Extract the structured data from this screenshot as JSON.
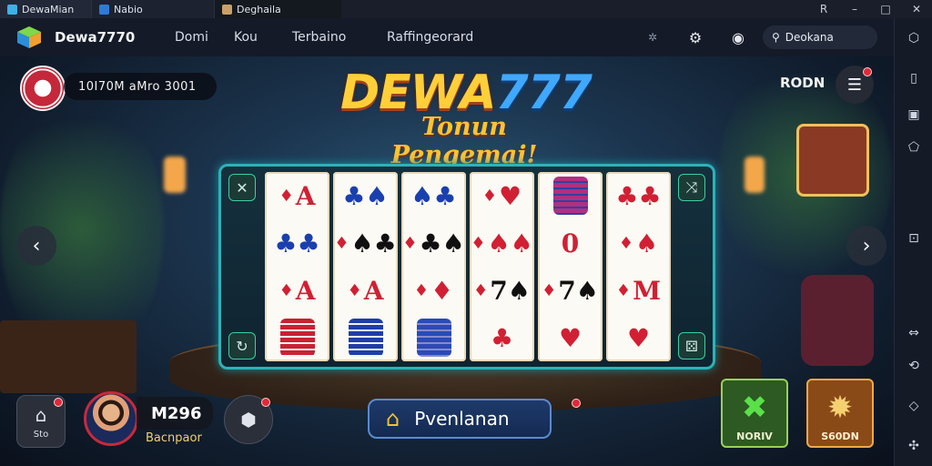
{
  "window": {
    "tabs": [
      {
        "label": "DewaMian",
        "icon": "app-icon"
      },
      {
        "label": "Nabio",
        "icon": "window-icon"
      },
      {
        "label": "Deghaila",
        "icon": "page-icon"
      }
    ],
    "controls": [
      "R",
      "–",
      "□",
      "✕"
    ]
  },
  "nav": {
    "brand": "Dewa7770",
    "links": [
      "Domi",
      "Kou",
      "Terbaino",
      "Raffingeorard"
    ],
    "search_label": "Deokana"
  },
  "game": {
    "coins": "10I70M aMro 3001",
    "title_text": "DEWA",
    "title_num": "777",
    "subtitle": "Tonun Pengemai!",
    "top_right_label": "RODN",
    "reels": [
      [
        {
          "t": "A",
          "s": "♦",
          "c": "red"
        },
        {
          "t": "♣♣",
          "s": "",
          "c": "blue"
        },
        {
          "t": "A",
          "s": "♦",
          "c": "red"
        },
        {
          "t": "chips-red",
          "s": "",
          "c": "red"
        }
      ],
      [
        {
          "t": "♣♠",
          "s": "",
          "c": "blue"
        },
        {
          "t": "♠♣",
          "s": "♦",
          "c": "black"
        },
        {
          "t": "A",
          "s": "♦",
          "c": "red"
        },
        {
          "t": "chips-blue",
          "s": "",
          "c": "blue"
        }
      ],
      [
        {
          "t": "♠♣",
          "s": "",
          "c": "blue"
        },
        {
          "t": "♣♠",
          "s": "♦",
          "c": "black"
        },
        {
          "t": "♦",
          "s": "♦",
          "c": "red"
        },
        {
          "t": "chips-mixed",
          "s": "",
          "c": "blue"
        }
      ],
      [
        {
          "t": "♥",
          "s": "♦",
          "c": "red"
        },
        {
          "t": "♠♠",
          "s": "♦",
          "c": "red"
        },
        {
          "t": "7♠",
          "s": "♦",
          "c": "black"
        },
        {
          "t": "♣",
          "s": "",
          "c": "red"
        }
      ],
      [
        {
          "t": "chips",
          "s": "",
          "c": "red"
        },
        {
          "t": "0",
          "s": "",
          "c": "red"
        },
        {
          "t": "7♠",
          "s": "♦",
          "c": "black"
        },
        {
          "t": "♥",
          "s": "",
          "c": "red"
        }
      ],
      [
        {
          "t": "♣♣",
          "s": "",
          "c": "red"
        },
        {
          "t": "♠",
          "s": "♦",
          "c": "red"
        },
        {
          "t": "M",
          "s": "♦",
          "c": "red"
        },
        {
          "t": "♥",
          "s": "",
          "c": "red"
        }
      ]
    ]
  },
  "bottom": {
    "home_label": "Sto",
    "player_name": "M296",
    "player_sub": "Bacnpaor",
    "primary_label": "Pvenlanan",
    "green_btn_label": "NORIV",
    "orange_btn_label": "S60DN"
  }
}
